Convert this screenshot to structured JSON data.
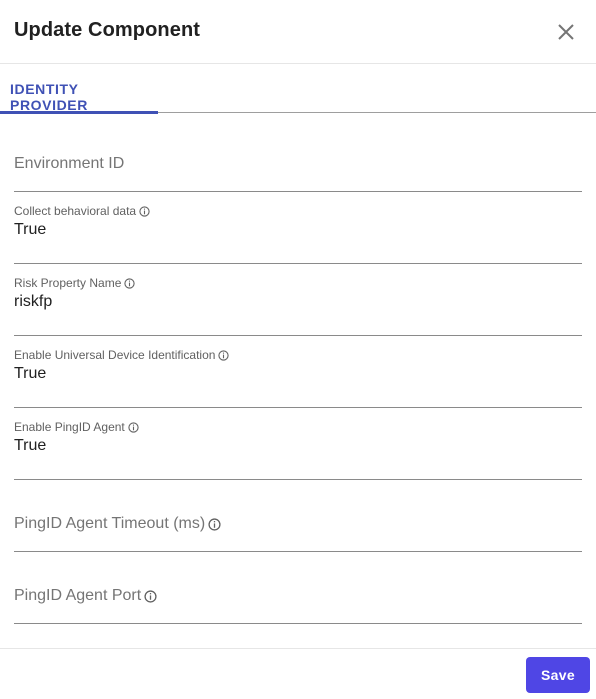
{
  "dialog": {
    "title": "Update Component",
    "close_icon": "close-icon"
  },
  "tabs": [
    {
      "label": "IDENTITY PROVIDER",
      "active": true
    }
  ],
  "fields": {
    "environment_id": {
      "label": "Environment ID",
      "value": ""
    },
    "collect_behavioral_data": {
      "label": "Collect behavioral data",
      "value": "True",
      "icon": "info-icon"
    },
    "risk_property_name": {
      "label": "Risk Property Name",
      "value": "riskfp",
      "icon": "info-icon"
    },
    "enable_udi": {
      "label": "Enable Universal Device Identification",
      "value": "True",
      "icon": "info-icon"
    },
    "enable_pingid_agent": {
      "label": "Enable PingID Agent",
      "value": "True",
      "icon": "info-icon"
    },
    "pingid_agent_timeout": {
      "label": "PingID Agent Timeout (ms)",
      "value": "",
      "icon": "info-icon"
    },
    "pingid_agent_port": {
      "label": "PingID Agent Port",
      "value": "",
      "icon": "info-icon"
    }
  },
  "footer": {
    "save_label": "Save"
  },
  "colors": {
    "accent": "#3f51b5",
    "save_button": "#4f46e5"
  }
}
